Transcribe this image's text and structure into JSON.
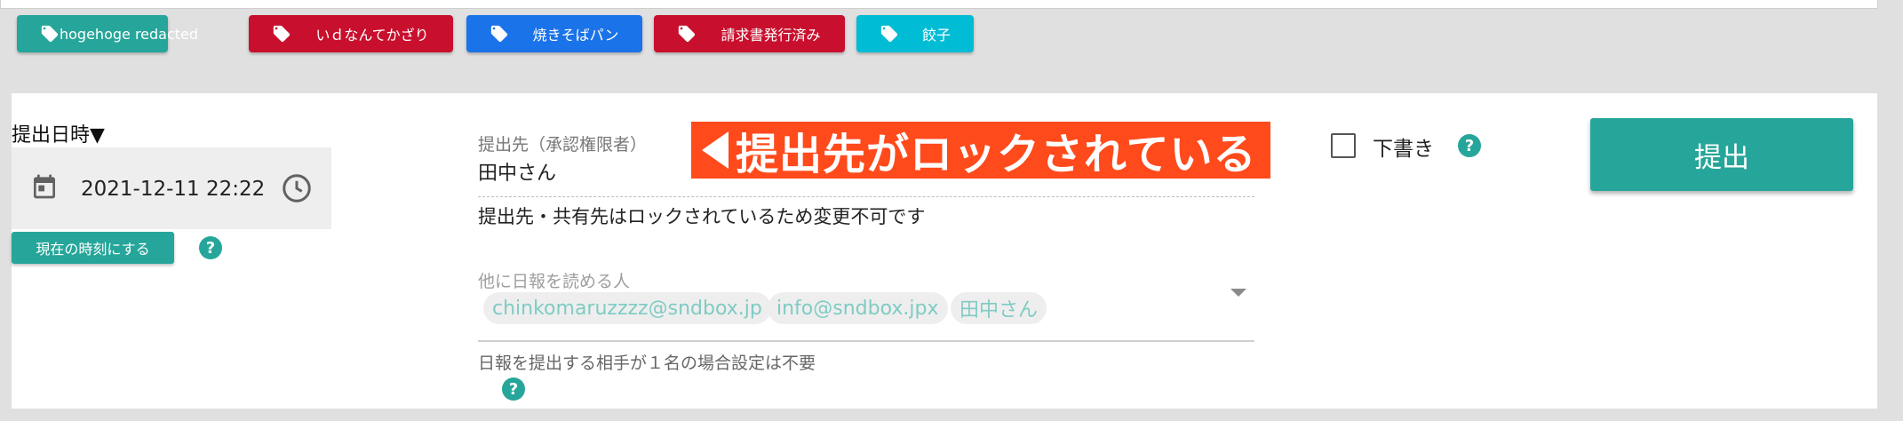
{
  "tags": [
    {
      "label": "hogehoge redacted",
      "color": "#26a69a"
    },
    {
      "label": "いｄなんてかざり",
      "color": "#c8102e"
    },
    {
      "label": "焼きそばパン",
      "color": "#1a73e8"
    },
    {
      "label": "請求書発行済み",
      "color": "#c8102e"
    },
    {
      "label": "餃子",
      "color": "#00bcd4"
    }
  ],
  "datetime": {
    "label": "提出日時▼",
    "value": "2021-12-11 22:22",
    "now_button": "現在の時刻にする",
    "help": "?"
  },
  "destination": {
    "label": "提出先（承認権限者）",
    "value": "田中さん",
    "lock_banner": "提出先がロックされている",
    "lock_note": "提出先・共有先はロックされているため変更不可です"
  },
  "readers": {
    "label": "他に日報を読める人",
    "chips": [
      "chinkomaruzzzz@sndbox.jp",
      "info@sndbox.jpx",
      "田中さん"
    ],
    "hint": "日報を提出する相手が１名の場合設定は不要",
    "help": "?"
  },
  "draft": {
    "label": "下書き",
    "checked": false,
    "help": "?"
  },
  "submit": {
    "label": "提出"
  },
  "colors": {
    "accent": "#26a69a",
    "banner": "#ff4a1c"
  },
  "icons": {
    "tag": "tag-icon",
    "calendar": "calendar-icon",
    "clock": "clock-icon",
    "help": "help-icon"
  }
}
